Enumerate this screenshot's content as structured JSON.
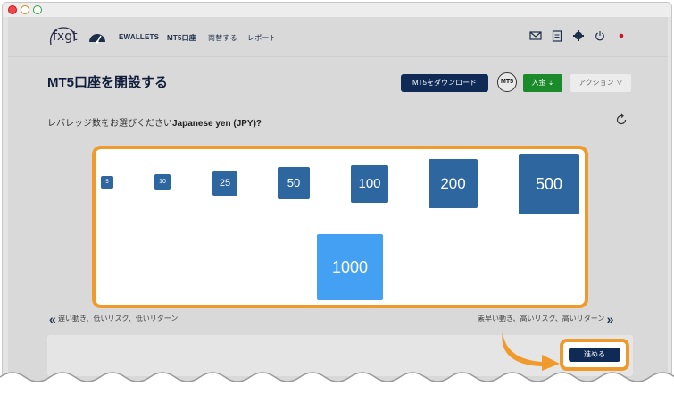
{
  "header": {
    "logo_text": "fxgt",
    "nav": [
      "EWALLETS",
      "MT5口座",
      "両替する",
      "レポート"
    ],
    "icons": [
      "mail-icon",
      "clipboard-icon",
      "gear-icon",
      "power-icon",
      "flag-icon"
    ]
  },
  "page": {
    "title": "MT5口座を開設する",
    "download_label": "MT5をダウンロード",
    "mt5_label": "MT5",
    "deposit_label": "入金 ⇣",
    "action_label": "アクション ∨"
  },
  "question": {
    "prefix": "レバレッジ数をお選びください",
    "currency": "Japanese yen (JPY)?"
  },
  "leverage": {
    "options": [
      "5",
      "10",
      "25",
      "50",
      "100",
      "200",
      "500",
      "1000"
    ],
    "selected": "1000"
  },
  "hints": {
    "left": "遅い動き、低いリスク、低いリターン",
    "right": "素早い動き、高いリスク、高いリターン"
  },
  "next_label": "進める",
  "colors": {
    "highlight": "#f09a2c",
    "primary": "#0e2a55",
    "option": "#2e66a0",
    "option_selected": "#43a0f2",
    "deposit": "#1a8a2a"
  }
}
